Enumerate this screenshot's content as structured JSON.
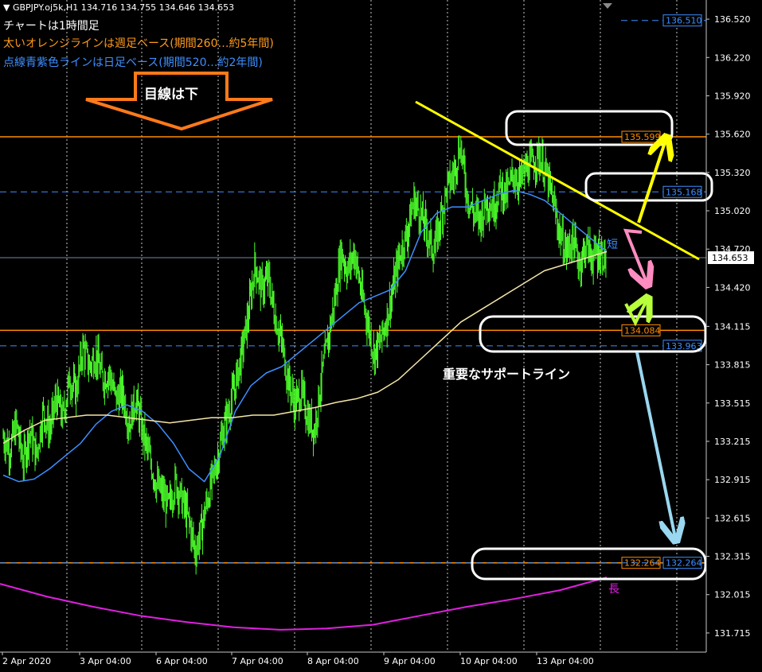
{
  "header": {
    "symbol_line": "GBPJPY.oj5k,H1  134.716 134.755 134.646 134.653",
    "note_1": "チャートは1時間足",
    "note_2": "太いオレンジラインは週足ベース(期間260…約5年間)",
    "note_3": "点線青紫色ラインは日足ベース(期間520…約2年間)"
  },
  "annotations": {
    "arrow_text": "目線は下",
    "support_text": "重要なサポートライン",
    "short_label": "短",
    "long_label": "長"
  },
  "chart_data": {
    "type": "candlestick",
    "title": "",
    "xlabel": "",
    "ylabel": "",
    "ylim": [
      131.565,
      136.67
    ],
    "y_ticks": [
      "136.520",
      "136.220",
      "135.920",
      "135.620",
      "135.320",
      "135.020",
      "134.720",
      "134.420",
      "134.115",
      "133.815",
      "133.515",
      "133.215",
      "132.915",
      "132.615",
      "132.315",
      "132.015",
      "131.715"
    ],
    "x_ticks": [
      "2 Apr 2020",
      "3 Apr 04:00",
      "6 Apr 04:00",
      "7 Apr 04:00",
      "8 Apr 04:00",
      "9 Apr 04:00",
      "10 Apr 04:00",
      "13 Apr 04:00"
    ],
    "current_price": "134.653",
    "grid": "vertical dotted",
    "levels": [
      {
        "value": 136.51,
        "label": "136.510",
        "style": "dashed",
        "color": "#3d8fff"
      },
      {
        "value": 135.599,
        "label": "135.599",
        "style": "solid",
        "color": "#ff8c00"
      },
      {
        "value": 135.168,
        "label": "135.168",
        "style": "dashed",
        "color": "#3d8fff"
      },
      {
        "value": 134.084,
        "label": "134.084",
        "style": "solid",
        "color": "#ff8c00"
      },
      {
        "value": 133.963,
        "label": "133.963",
        "style": "dashed",
        "color": "#3d8fff"
      },
      {
        "value": 132.264,
        "label": "132.264",
        "style": "solid",
        "color": "#ff8c00"
      },
      {
        "value": 132.264,
        "label": "132.264",
        "style": "dashed",
        "color": "#3d8fff"
      }
    ],
    "close_path": [
      133.25,
      133.15,
      133.35,
      133.05,
      133.3,
      133.1,
      133.45,
      133.3,
      133.55,
      133.4,
      133.7,
      133.6,
      133.95,
      133.8,
      133.9,
      133.7,
      133.75,
      133.55,
      133.6,
      133.35,
      133.55,
      133.3,
      133.1,
      132.9,
      132.8,
      132.7,
      132.9,
      132.75,
      132.6,
      132.35,
      132.55,
      132.8,
      133.0,
      133.25,
      133.45,
      133.65,
      133.9,
      134.2,
      134.6,
      134.4,
      134.5,
      134.2,
      134.0,
      133.7,
      133.5,
      133.6,
      133.4,
      133.3,
      133.7,
      134.0,
      134.3,
      134.7,
      134.55,
      134.7,
      134.4,
      134.15,
      133.9,
      134.0,
      134.2,
      134.45,
      134.7,
      134.85,
      135.1,
      135.0,
      134.85,
      134.7,
      134.95,
      135.2,
      135.3,
      135.55,
      135.15,
      135.0,
      134.95,
      135.1,
      135.05,
      135.2,
      135.15,
      135.3,
      135.25,
      135.35,
      135.4,
      135.45,
      135.3,
      135.1,
      134.85,
      134.7,
      134.8,
      134.6,
      134.75,
      134.65,
      134.7,
      134.65
    ],
    "series": [
      {
        "name": "短",
        "color": "#3d8fff",
        "values": [
          132.95,
          132.9,
          132.92,
          133.0,
          133.1,
          133.2,
          133.35,
          133.45,
          133.5,
          133.45,
          133.35,
          133.2,
          133.0,
          132.9,
          133.1,
          133.45,
          133.65,
          133.75,
          133.8,
          133.9,
          134.0,
          134.1,
          134.2,
          134.3,
          134.35,
          134.4,
          134.55,
          134.85,
          135.0,
          135.05,
          135.05,
          135.1,
          135.15,
          135.18,
          135.15,
          135.1,
          135.0,
          134.9,
          134.8,
          134.7
        ]
      },
      {
        "name": "",
        "color": "#f5e6a8",
        "values": [
          133.2,
          133.3,
          133.38,
          133.4,
          133.42,
          133.42,
          133.4,
          133.38,
          133.36,
          133.38,
          133.4,
          133.4,
          133.42,
          133.42,
          133.45,
          133.48,
          133.52,
          133.55,
          133.6,
          133.7,
          133.85,
          134.0,
          134.15,
          134.25,
          134.35,
          134.45,
          134.55,
          134.6,
          134.65,
          134.7
        ]
      },
      {
        "name": "長",
        "color": "#e020e0",
        "values": [
          132.1,
          132.0,
          131.92,
          131.85,
          131.8,
          131.76,
          131.74,
          131.75,
          131.78,
          131.85,
          131.92,
          131.98,
          132.05,
          132.15
        ]
      }
    ]
  }
}
